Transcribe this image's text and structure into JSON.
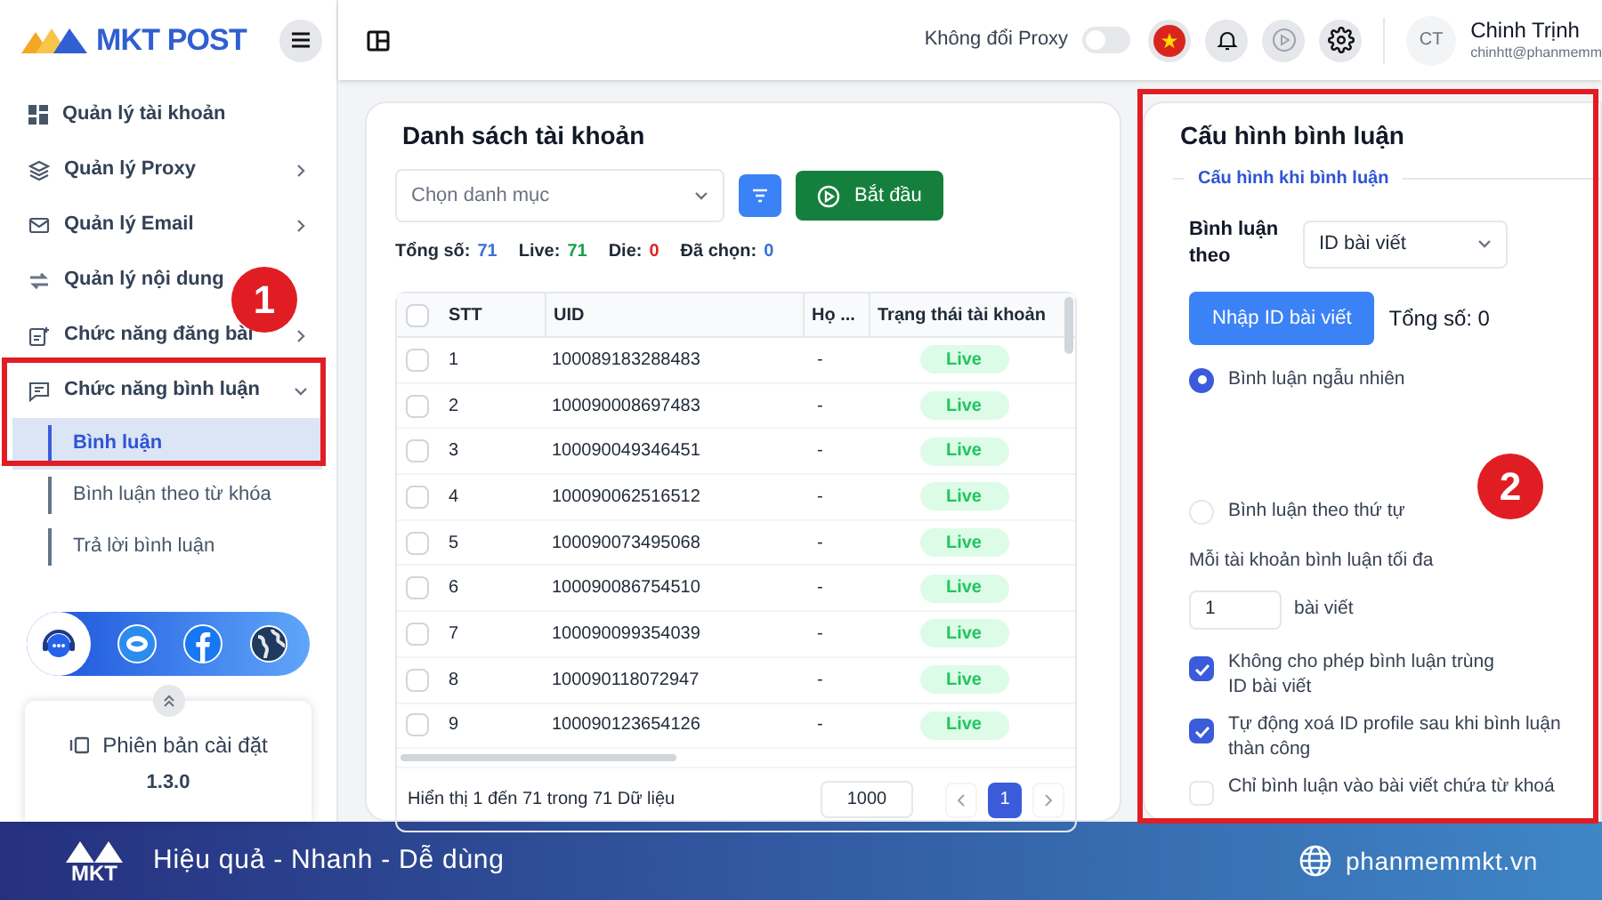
{
  "app": {
    "logo_text": "MKT POST"
  },
  "sidebar": {
    "items": [
      {
        "label": "Quản lý tài khoản",
        "kind": "link"
      },
      {
        "label": "Quản lý Proxy",
        "kind": "group",
        "expanded": false
      },
      {
        "label": "Quản lý Email",
        "kind": "group",
        "expanded": false
      },
      {
        "label": "Quản lý nội dung",
        "kind": "link"
      },
      {
        "label": "Chức năng đăng bài",
        "kind": "group",
        "expanded": false
      },
      {
        "label": "Chức năng bình luận",
        "kind": "group",
        "expanded": true,
        "children": [
          {
            "label": "Bình luận",
            "selected": true
          },
          {
            "label": "Bình luận theo từ khóa",
            "selected": false
          },
          {
            "label": "Trả lời bình luận",
            "selected": false
          }
        ]
      }
    ],
    "version": {
      "label": "Phiên bản cài đặt",
      "number": "1.3.0"
    }
  },
  "header": {
    "proxy_toggle": {
      "label": "Không đổi Proxy",
      "on": false
    },
    "user": {
      "initials": "CT",
      "name": "Chinh Trịnh",
      "email": "chinhtt@phanmemm"
    }
  },
  "accounts": {
    "title": "Danh sách tài khoản",
    "category_select": {
      "placeholder": "Chọn danh mục"
    },
    "start_button": "Bắt đầu",
    "stats": [
      {
        "label": "Tổng số:",
        "value": "71",
        "color": "#3b6fd8"
      },
      {
        "label": "Live:",
        "value": "71",
        "color": "#16a34a"
      },
      {
        "label": "Die:",
        "value": "0",
        "color": "#dc2626"
      },
      {
        "label": "Đã chọn:",
        "value": "0",
        "color": "#3b6fd8"
      }
    ],
    "table": {
      "select_all_checked": false,
      "columns": [
        "STT",
        "UID",
        "Họ ...",
        "Trạng thái tài khoản"
      ],
      "rows": [
        {
          "stt": "1",
          "uid": "100089183288483",
          "name": "-",
          "status": "Live",
          "checked": false
        },
        {
          "stt": "2",
          "uid": "100090008697483",
          "name": "-",
          "status": "Live",
          "checked": false
        },
        {
          "stt": "3",
          "uid": "100090049346451",
          "name": "-",
          "status": "Live",
          "checked": false
        },
        {
          "stt": "4",
          "uid": "100090062516512",
          "name": "-",
          "status": "Live",
          "checked": false
        },
        {
          "stt": "5",
          "uid": "100090073495068",
          "name": "-",
          "status": "Live",
          "checked": false
        },
        {
          "stt": "6",
          "uid": "100090086754510",
          "name": "-",
          "status": "Live",
          "checked": false
        },
        {
          "stt": "7",
          "uid": "100090099354039",
          "name": "-",
          "status": "Live",
          "checked": false
        },
        {
          "stt": "8",
          "uid": "100090118072947",
          "name": "-",
          "status": "Live",
          "checked": false
        },
        {
          "stt": "9",
          "uid": "100090123654126",
          "name": "-",
          "status": "Live",
          "checked": false
        }
      ]
    },
    "footer": {
      "summary": "Hiển thị 1 đến 71 trong 71 Dữ liệu",
      "page_size": "1000",
      "pages": [
        {
          "label": "1",
          "selected": true
        }
      ]
    }
  },
  "config": {
    "title": "Cấu hình bình luận",
    "section": "Cấu hình khi bình luận",
    "comment_by": {
      "label": "Bình luận theo",
      "value": "ID bài viết"
    },
    "import_button": "Nhập ID bài viết",
    "total": "Tổng số: 0",
    "modes": [
      {
        "label": "Bình luận ngẫu nhiên",
        "selected": true
      },
      {
        "label": "Bình luận theo thứ tự",
        "selected": false
      }
    ],
    "max_label": "Mỗi tài khoản bình luận tối đa",
    "max_value": "1",
    "max_unit": "bài viết",
    "options": [
      {
        "label": "Không cho phép bình luận trùng ID bài viết",
        "checked": true
      },
      {
        "label": "Tự động xoá ID profile sau khi bình luận thàn công",
        "checked": true
      },
      {
        "label": "Chỉ bình luận vào bài viết chứa từ khoá",
        "checked": false
      }
    ]
  },
  "annotations": [
    {
      "number": "1"
    },
    {
      "number": "2"
    }
  ],
  "banner": {
    "logo_text": "MKT",
    "tagline": "Hiệu quả - Nhanh - Dễ dùng",
    "website": "phanmemmkt.vn"
  }
}
